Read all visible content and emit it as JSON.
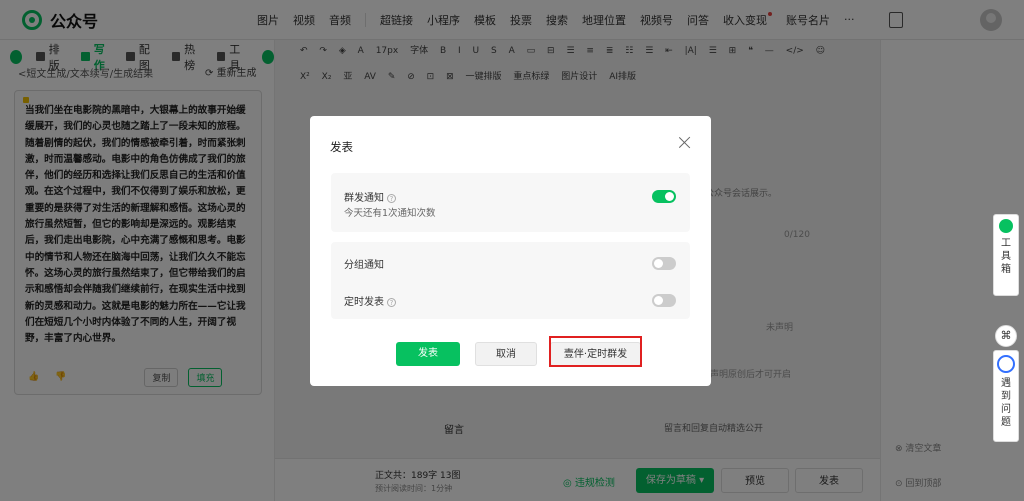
{
  "app": {
    "title": "公众号"
  },
  "topnav": {
    "items": [
      "图片",
      "视频",
      "音频",
      "超链接",
      "小程序",
      "模板",
      "投票",
      "搜索",
      "地理位置",
      "视频号",
      "问答",
      "收入变现",
      "账号名片",
      "···"
    ]
  },
  "toolbar": {
    "row1": [
      "↶",
      "↷",
      "◈",
      "A",
      "17px",
      "字体",
      "B",
      "I",
      "U",
      "S",
      "A",
      "▭",
      "⊟",
      "☰",
      "≡",
      "≣",
      "☷",
      "☰",
      "⇤",
      "|A|",
      "☰",
      "⊞",
      "❝",
      "—",
      "</>",
      "☺"
    ],
    "row2": [
      "X²",
      "X₂",
      "亚",
      "AV",
      "✎",
      "⊘",
      "⊡",
      "⊠",
      "一键排版",
      "重点标绿",
      "图片设计",
      "AI排版"
    ]
  },
  "left": {
    "tabs": [
      {
        "label": "排版",
        "active": false
      },
      {
        "label": "写作",
        "active": true
      },
      {
        "label": "配图",
        "active": false
      },
      {
        "label": "热榜",
        "active": false
      },
      {
        "label": "工具",
        "active": false
      }
    ],
    "breadcrumb": "<短文生成/文本续写/生成结果",
    "regenerate": "重新生成",
    "text": "当我们坐在电影院的黑暗中，大银幕上的故事开始缓缓展开，我们的心灵也随之踏上了一段未知的旅程。随着剧情的起伏，我们的情感被牵引着，时而紧张刺激，时而温馨感动。电影中的角色仿佛成了我们的旅伴，他们的经历和选择让我们反思自己的生活和价值观。在这个过程中，我们不仅得到了娱乐和放松，更重要的是获得了对生活的新理解和感悟。这场心灵的旅行虽然短暂，但它的影响却是深远的。观影结束后，我们走出电影院，心中充满了感慨和思考。电影中的情节和人物还在脑海中回荡，让我们久久不能忘怀。这场心灵的旅行虽然结束了，但它带给我们的启示和感悟却会伴随我们继续前行，在现实生活中找到新的灵感和动力。这就是电影的魅力所在——它让我们在短短几个小时内体验了不同的人生，开阔了视野，丰富了内心世界。",
    "copy": "复制",
    "fill": "填充"
  },
  "editor": {
    "hint": "公众号会话展示。",
    "counter": "0/120",
    "declare": "未声明",
    "open_hint": "声明原创后才可开启",
    "comment_label": "留言",
    "comment_value": "留言和回复自动精选公开"
  },
  "bottom": {
    "stats": "正文共：189字 13图",
    "read_time": "预计阅读时间：1分钟",
    "violation": "违规检测",
    "save_draft": "保存为草稿",
    "preview": "预览",
    "publish": "发表"
  },
  "right": {
    "tool": "工具箱",
    "ask": "遇到问题",
    "clear": "清空文章",
    "top": "回到顶部"
  },
  "modal": {
    "title": "发表",
    "mass": {
      "label": "群发通知",
      "sub": "今天还有1次通知次数",
      "on": true
    },
    "group": {
      "label": "分组通知",
      "on": false
    },
    "scheduled": {
      "label": "定时发表",
      "on": false
    },
    "publish": "发表",
    "cancel": "取消",
    "schedule_btn": "壹伴·定时群发"
  },
  "colors": {
    "accent": "#07c160",
    "highlight": "#e02020"
  }
}
